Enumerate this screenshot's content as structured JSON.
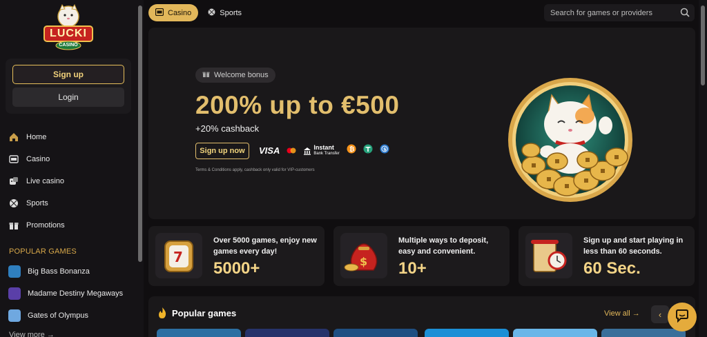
{
  "brand": {
    "logo_text": "LUCKI",
    "logo_sub": "CASINO"
  },
  "auth": {
    "signup_label": "Sign up",
    "login_label": "Login"
  },
  "nav": {
    "items": [
      {
        "label": "Home",
        "icon": "home-icon"
      },
      {
        "label": "Casino",
        "icon": "slot-machine-icon"
      },
      {
        "label": "Live casino",
        "icon": "dice-icon"
      },
      {
        "label": "Sports",
        "icon": "ball-icon"
      },
      {
        "label": "Promotions",
        "icon": "gift-icon"
      }
    ]
  },
  "popular_section": {
    "title": "POPULAR GAMES",
    "games": [
      {
        "label": "Big Bass Bonanza",
        "color": "#2f7fbf"
      },
      {
        "label": "Madame Destiny Megaways",
        "color": "#5a3fa8"
      },
      {
        "label": "Gates of Olympus",
        "color": "#6fa8e0"
      }
    ],
    "view_more": "View more"
  },
  "header": {
    "tabs": [
      {
        "label": "Casino",
        "active": true,
        "icon": "slot-icon"
      },
      {
        "label": "Sports",
        "active": false,
        "icon": "ball-icon"
      }
    ],
    "search_placeholder": "Search for games or providers"
  },
  "hero": {
    "pill": "Welcome bonus",
    "headline": "200% up to €500",
    "subline": "+20% cashback",
    "cta": "Sign up now",
    "payments": {
      "visa": "VISA",
      "instant": "Instant",
      "instant_sub": "Bank Transfer"
    },
    "terms": "Terms & Conditions apply, cashback only valid for VIP-customers"
  },
  "stats": [
    {
      "text": "Over 5000 games, enjoy new games every day!",
      "value": "5000+",
      "icon": "slot-reel-icon"
    },
    {
      "text": "Multiple ways to deposit, easy and convenient.",
      "value": "10+",
      "icon": "money-bag-icon"
    },
    {
      "text": "Sign up and start playing in less than 60 seconds.",
      "value": "60 Sec.",
      "icon": "scroll-clock-icon"
    }
  ],
  "popular": {
    "title": "Popular games",
    "view_all": "View all"
  },
  "colors": {
    "accent": "#e2b75a",
    "background": "#100e10",
    "panel": "#1c1a1c"
  }
}
